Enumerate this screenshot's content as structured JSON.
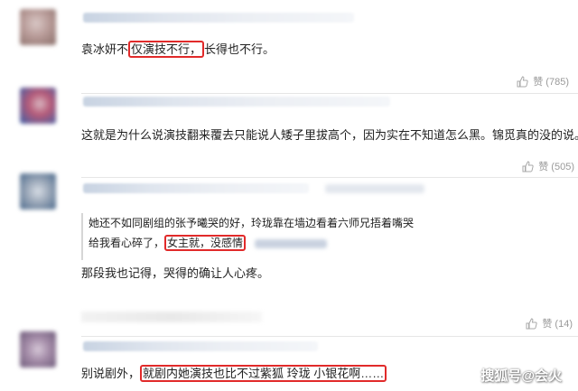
{
  "comments": [
    {
      "text_before": "袁冰妍不",
      "text_highlight": "仅演技不行，",
      "text_after": "长得也不行。",
      "likes_label": "赞 (785)",
      "avatar_colors": [
        "#8a6f6a",
        "#b89b98",
        "#d9c8c6"
      ]
    },
    {
      "text": "这就是为什么说演技翻来覆去只能说人矮子里拔高个，因为实在不知道怎么黑。锦觅真的没的说。",
      "likes_label": "赞 (505)",
      "avatar_colors": [
        "#3b5fa8",
        "#b55a78",
        "#d8b6c0"
      ]
    },
    {
      "quote_line1": "她还不如同剧组的张予曦哭的好，玲珑靠在墙边看着六师兄捂着嘴哭",
      "quote_line2_before": "给我看心碎了，",
      "quote_line2_highlight": "女主就，没感情",
      "text": "那段我也记得，哭得的确让人心疼。",
      "likes_label": "赞 (14)",
      "avatar_colors": [
        "#4c6a8c",
        "#9aa7b8",
        "#d7dde5"
      ]
    },
    {
      "text_before": "别说剧外，",
      "text_highlight": "就剧内她演技也比不过紫狐 玲珑 小银花啊……",
      "avatar_colors": [
        "#6e5b7a",
        "#a48ca8",
        "#d6c8d8"
      ]
    }
  ],
  "icons": {
    "like": "thumbs-up-icon"
  },
  "watermark": "搜狐号@会火",
  "colors": {
    "highlight_border": "#e12a2a",
    "like_text": "#9a9a9a"
  }
}
